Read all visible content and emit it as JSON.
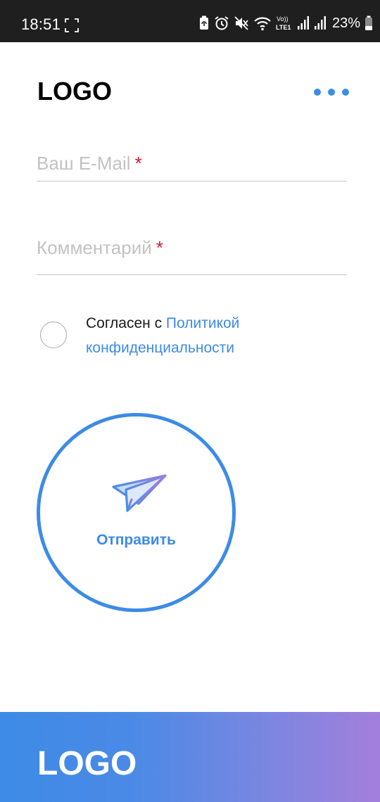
{
  "status_bar": {
    "time": "18:51",
    "battery_percent": "23%",
    "network_label_top": "Vo))",
    "network_label_bottom": "LTE1",
    "icons": [
      "screenshot-icon",
      "battery-saver-icon",
      "alarm-icon",
      "mute-icon",
      "wifi-icon",
      "volte-icon",
      "signal-icon",
      "signal-icon",
      "battery-icon"
    ]
  },
  "header": {
    "logo": "LOGO",
    "menu_icon": "more-dots-icon"
  },
  "form": {
    "email": {
      "placeholder": "Ваш E-Mail",
      "required_mark": "*"
    },
    "comment": {
      "placeholder": "Комментарий",
      "required_mark": "*"
    },
    "consent": {
      "text": "Согласен с ",
      "link": "Политикой конфиденциальности",
      "checked": false
    },
    "submit": {
      "label": "Отправить",
      "icon": "paper-plane-icon"
    }
  },
  "footer": {
    "logo": "LOGO"
  },
  "colors": {
    "accent": "#3d8be6",
    "required": "#d3182c",
    "placeholder": "#c2c2c2",
    "footer_gradient_start": "#3d8be6",
    "footer_gradient_end": "#a37fdb",
    "status_bar_bg": "#1f1f1f"
  }
}
